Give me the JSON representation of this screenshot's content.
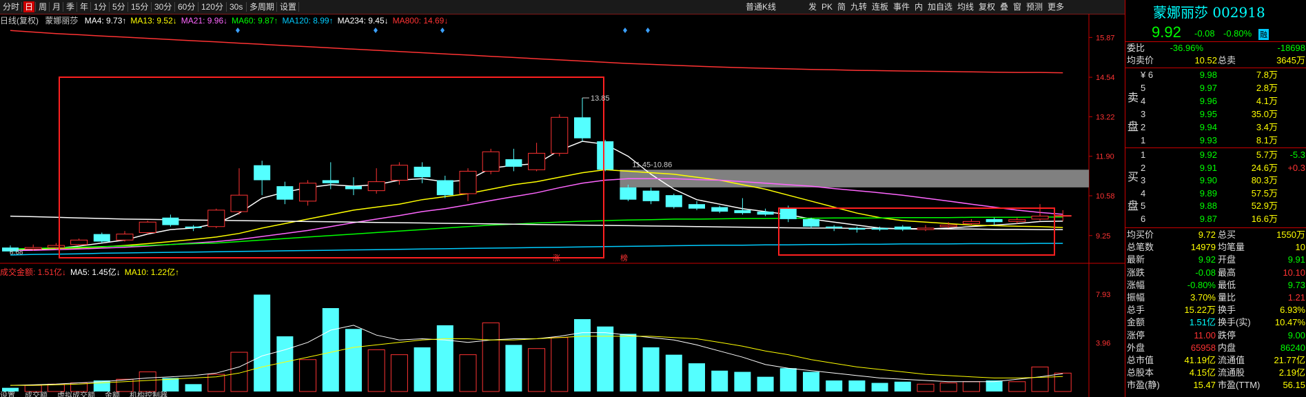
{
  "toolbar": {
    "items": [
      "分时",
      "日",
      "周",
      "月",
      "季",
      "年",
      "1分",
      "5分",
      "15分",
      "30分",
      "60分",
      "120分",
      "30s",
      "多周期",
      "设置"
    ],
    "selected": "日",
    "right_items": [
      "普通K线",
      "发",
      "PK",
      "简",
      "九转",
      "连板",
      "事件",
      "内",
      "加自选",
      "均线",
      "复权",
      "叠",
      "窗",
      "预测",
      "更多"
    ]
  },
  "ma_row": {
    "prefix": "日线(复权)",
    "stock": "蒙娜丽莎",
    "items": [
      {
        "label": "MA4: 9.73↑",
        "color": "#ffffff"
      },
      {
        "label": "MA13: 9.52↓",
        "color": "#ffff00"
      },
      {
        "label": "MA21: 9.96↓",
        "color": "#ff66ff"
      },
      {
        "label": "MA60: 9.87↑",
        "color": "#00ff00"
      },
      {
        "label": "MA120: 8.99↑",
        "color": "#00ccff"
      },
      {
        "label": "MA234: 9.45↓",
        "color": "#ffffff"
      },
      {
        "label": "MA800: 14.69↓",
        "color": "#ff3333"
      }
    ]
  },
  "price_axis": [
    "15.87",
    "14.54",
    "13.22",
    "11.90",
    "10.58",
    "9.25"
  ],
  "volume_axis": [
    "7.93",
    "3.96"
  ],
  "annotations": {
    "high_label": "13.85",
    "gap_label": "11.45-10.86",
    "low_label": "8.68",
    "markers": [
      "涨",
      "榜"
    ]
  },
  "volume_row": {
    "items": [
      {
        "label": "成交金额: 1.51亿↓",
        "color": "#ff3333"
      },
      {
        "label": "MA5: 1.45亿↓",
        "color": "#ffffff"
      },
      {
        "label": "MA10: 1.22亿↑",
        "color": "#ffff00"
      }
    ]
  },
  "bottom_tabs": [
    "设置",
    "成交额",
    "虚拟成交额",
    "金额",
    "机构控制器"
  ],
  "panel": {
    "title": "蒙娜丽莎 002918",
    "price": "9.92",
    "change": "-0.08",
    "change_pct": "-0.80%",
    "badge": "融",
    "weibi_label": "委比",
    "weibi_val": "-36.96%",
    "weicha_val": "-18698",
    "junmai_label": "均卖价",
    "junmai_val": "10.52",
    "zongmai_label": "总卖",
    "zongmai_val": "3645万",
    "sell_side_label": [
      "卖",
      "盘"
    ],
    "sell": [
      {
        "lvl": "¥ 6",
        "price": "9.98",
        "vol": "7.8万"
      },
      {
        "lvl": "5",
        "price": "9.97",
        "vol": "2.8万"
      },
      {
        "lvl": "4",
        "price": "9.96",
        "vol": "4.1万"
      },
      {
        "lvl": "3",
        "price": "9.95",
        "vol": "35.0万"
      },
      {
        "lvl": "2",
        "price": "9.94",
        "vol": "3.4万"
      },
      {
        "lvl": "1",
        "price": "9.93",
        "vol": "8.1万"
      }
    ],
    "buy_side_label": [
      "买",
      "盘"
    ],
    "buy": [
      {
        "lvl": "1",
        "price": "9.92",
        "vol": "5.7万",
        "chg": "-5.3"
      },
      {
        "lvl": "2",
        "price": "9.91",
        "vol": "24.6万",
        "chg": "+0.3"
      },
      {
        "lvl": "3",
        "price": "9.90",
        "vol": "80.3万",
        "chg": ""
      },
      {
        "lvl": "4",
        "price": "9.89",
        "vol": "57.5万",
        "chg": ""
      },
      {
        "lvl": "5",
        "price": "9.88",
        "vol": "52.9万",
        "chg": ""
      },
      {
        "lvl": "6",
        "price": "9.87",
        "vol": "16.6万",
        "chg": ""
      }
    ],
    "stats": [
      {
        "l1": "均买价",
        "v1": "9.72",
        "c1": "#ffff00",
        "l2": "总买",
        "v2": "1550万",
        "c2": "#ffff00"
      },
      {
        "l1": "总笔数",
        "v1": "14979",
        "c1": "#ffff00",
        "l2": "均笔量",
        "v2": "10",
        "c2": "#ffff00"
      },
      {
        "l1": "最新",
        "v1": "9.92",
        "c1": "#00ff00",
        "l2": "开盘",
        "v2": "9.91",
        "c2": "#00ff00"
      },
      {
        "l1": "涨跌",
        "v1": "-0.08",
        "c1": "#00ff00",
        "l2": "最高",
        "v2": "10.10",
        "c2": "#ff3333"
      },
      {
        "l1": "涨幅",
        "v1": "-0.80%",
        "c1": "#00ff00",
        "l2": "最低",
        "v2": "9.73",
        "c2": "#00ff00"
      },
      {
        "l1": "振幅",
        "v1": "3.70%",
        "c1": "#ffff00",
        "l2": "量比",
        "v2": "1.21",
        "c2": "#ff3333"
      },
      {
        "l1": "总手",
        "v1": "15.22万",
        "c1": "#ffff00",
        "l2": "换手",
        "v2": "6.93%",
        "c2": "#ffff00"
      },
      {
        "l1": "金额",
        "v1": "1.51亿",
        "c1": "#00ffff",
        "l2": "换手(实)",
        "v2": "10.47%",
        "c2": "#ffff00"
      },
      {
        "l1": "涨停",
        "v1": "11.00",
        "c1": "#ff3333",
        "l2": "跌停",
        "v2": "9.00",
        "c2": "#00ff00"
      },
      {
        "l1": "外盘",
        "v1": "65958",
        "c1": "#ff3333",
        "l2": "内盘",
        "v2": "86240",
        "c2": "#00ff00"
      },
      {
        "l1": "总市值",
        "v1": "41.19亿",
        "c1": "#ffff00",
        "l2": "流通值",
        "v2": "21.77亿",
        "c2": "#ffff00"
      },
      {
        "l1": "总股本",
        "v1": "4.15亿",
        "c1": "#ffff00",
        "l2": "流通股",
        "v2": "2.19亿",
        "c2": "#ffff00"
      },
      {
        "l1": "市盈(静)",
        "v1": "15.47",
        "c1": "#ffff00",
        "l2": "市盈(TTM)",
        "v2": "56.15",
        "c2": "#ffff00"
      }
    ]
  },
  "chart_data": {
    "type": "candlestick",
    "price_range": [
      8.6,
      16.2
    ],
    "volume_max": 8.6,
    "candles": [
      {
        "o": 8.85,
        "c": 8.72,
        "h": 8.92,
        "l": 8.68,
        "v": 0.3
      },
      {
        "o": 8.8,
        "c": 8.85,
        "h": 8.95,
        "l": 8.75,
        "v": 0.5
      },
      {
        "o": 8.85,
        "c": 8.92,
        "h": 9.0,
        "l": 8.8,
        "v": 0.6
      },
      {
        "o": 8.95,
        "c": 9.1,
        "h": 9.15,
        "l": 8.9,
        "v": 0.7
      },
      {
        "o": 9.3,
        "c": 9.05,
        "h": 9.35,
        "l": 9.0,
        "v": 0.9
      },
      {
        "o": 9.1,
        "c": 9.3,
        "h": 9.4,
        "l": 9.05,
        "v": 1.0
      },
      {
        "o": 9.35,
        "c": 9.7,
        "h": 9.75,
        "l": 9.3,
        "v": 1.6
      },
      {
        "o": 9.85,
        "c": 9.6,
        "h": 9.95,
        "l": 9.55,
        "v": 1.1
      },
      {
        "o": 9.55,
        "c": 9.5,
        "h": 9.6,
        "l": 9.4,
        "v": 0.6
      },
      {
        "o": 9.55,
        "c": 10.1,
        "h": 10.15,
        "l": 9.5,
        "v": 1.4
      },
      {
        "o": 10.05,
        "c": 10.6,
        "h": 11.5,
        "l": 9.95,
        "v": 3.2
      },
      {
        "o": 11.6,
        "c": 11.1,
        "h": 11.75,
        "l": 10.6,
        "v": 7.9
      },
      {
        "o": 10.9,
        "c": 10.45,
        "h": 11.05,
        "l": 10.3,
        "v": 4.5
      },
      {
        "o": 10.4,
        "c": 11.0,
        "h": 11.1,
        "l": 10.25,
        "v": 2.6
      },
      {
        "o": 11.1,
        "c": 11.0,
        "h": 11.7,
        "l": 10.8,
        "v": 6.8
      },
      {
        "o": 10.9,
        "c": 10.8,
        "h": 11.2,
        "l": 10.6,
        "v": 5.1
      },
      {
        "o": 10.75,
        "c": 11.05,
        "h": 11.5,
        "l": 10.65,
        "v": 3.4
      },
      {
        "o": 11.1,
        "c": 11.6,
        "h": 11.7,
        "l": 10.95,
        "v": 3.0
      },
      {
        "o": 11.55,
        "c": 11.2,
        "h": 11.7,
        "l": 11.0,
        "v": 3.6
      },
      {
        "o": 11.1,
        "c": 10.6,
        "h": 11.25,
        "l": 10.5,
        "v": 5.4
      },
      {
        "o": 10.65,
        "c": 11.4,
        "h": 11.5,
        "l": 10.4,
        "v": 3.0
      },
      {
        "o": 11.4,
        "c": 12.05,
        "h": 12.15,
        "l": 11.3,
        "v": 5.6
      },
      {
        "o": 11.8,
        "c": 11.55,
        "h": 12.15,
        "l": 11.4,
        "v": 3.8
      },
      {
        "o": 11.45,
        "c": 12.0,
        "h": 12.35,
        "l": 11.4,
        "v": 3.5
      },
      {
        "o": 12.0,
        "c": 13.2,
        "h": 13.3,
        "l": 11.9,
        "v": 4.4
      },
      {
        "o": 13.2,
        "c": 12.5,
        "h": 13.85,
        "l": 12.4,
        "v": 5.9
      },
      {
        "o": 12.4,
        "c": 11.45,
        "h": 12.45,
        "l": 11.4,
        "v": 5.3
      },
      {
        "o": 10.86,
        "c": 10.45,
        "h": 10.95,
        "l": 10.4,
        "v": 4.7
      },
      {
        "o": 10.75,
        "c": 10.4,
        "h": 10.85,
        "l": 10.3,
        "v": 3.6
      },
      {
        "o": 10.6,
        "c": 10.2,
        "h": 10.65,
        "l": 10.15,
        "v": 3.0
      },
      {
        "o": 10.3,
        "c": 10.15,
        "h": 10.4,
        "l": 10.1,
        "v": 2.3
      },
      {
        "o": 10.2,
        "c": 10.05,
        "h": 10.25,
        "l": 10.0,
        "v": 1.7
      },
      {
        "o": 10.1,
        "c": 10.0,
        "h": 10.5,
        "l": 9.95,
        "v": 1.6
      },
      {
        "o": 10.05,
        "c": 9.95,
        "h": 10.15,
        "l": 9.9,
        "v": 1.2
      },
      {
        "o": 10.15,
        "c": 9.8,
        "h": 10.25,
        "l": 9.7,
        "v": 1.9
      },
      {
        "o": 9.8,
        "c": 9.55,
        "h": 9.85,
        "l": 9.5,
        "v": 1.6
      },
      {
        "o": 9.55,
        "c": 9.5,
        "h": 9.6,
        "l": 9.4,
        "v": 0.9
      },
      {
        "o": 9.5,
        "c": 9.45,
        "h": 9.55,
        "l": 9.35,
        "v": 0.9
      },
      {
        "o": 9.5,
        "c": 9.45,
        "h": 9.55,
        "l": 9.4,
        "v": 0.7
      },
      {
        "o": 9.55,
        "c": 9.45,
        "h": 9.6,
        "l": 9.4,
        "v": 0.8
      },
      {
        "o": 9.45,
        "c": 9.5,
        "h": 9.6,
        "l": 9.4,
        "v": 0.6
      },
      {
        "o": 9.55,
        "c": 9.6,
        "h": 9.7,
        "l": 9.5,
        "v": 0.7
      },
      {
        "o": 9.65,
        "c": 9.72,
        "h": 9.8,
        "l": 9.6,
        "v": 0.8
      },
      {
        "o": 9.8,
        "c": 9.7,
        "h": 9.85,
        "l": 9.6,
        "v": 0.9
      },
      {
        "o": 9.72,
        "c": 9.78,
        "h": 9.85,
        "l": 9.65,
        "v": 0.8
      },
      {
        "o": 9.8,
        "c": 9.9,
        "h": 10.3,
        "l": 9.75,
        "v": 2.0
      },
      {
        "o": 9.91,
        "c": 9.92,
        "h": 10.1,
        "l": 9.73,
        "v": 1.5
      }
    ],
    "ma": {
      "MA4": {
        "color": "#ffffff",
        "values": [
          8.75,
          8.78,
          8.82,
          8.9,
          9.0,
          9.1,
          9.3,
          9.45,
          9.5,
          9.65,
          10.0,
          10.5,
          10.7,
          10.85,
          10.95,
          10.9,
          10.95,
          11.1,
          11.15,
          11.05,
          11.1,
          11.5,
          11.6,
          11.65,
          12.1,
          12.4,
          12.3,
          11.9,
          11.3,
          10.8,
          10.45,
          10.3,
          10.15,
          10.05,
          9.95,
          9.8,
          9.7,
          9.6,
          9.5,
          9.47,
          9.47,
          9.5,
          9.55,
          9.6,
          9.65,
          9.72,
          9.73
        ]
      },
      "MA13": {
        "color": "#ffff00",
        "values": [
          8.8,
          8.8,
          8.82,
          8.84,
          8.87,
          8.92,
          8.98,
          9.05,
          9.12,
          9.2,
          9.32,
          9.5,
          9.65,
          9.8,
          9.95,
          10.1,
          10.2,
          10.3,
          10.45,
          10.55,
          10.65,
          10.8,
          10.95,
          11.05,
          11.2,
          11.35,
          11.45,
          11.4,
          11.35,
          11.3,
          11.2,
          11.1,
          10.95,
          10.8,
          10.6,
          10.4,
          10.2,
          10.0,
          9.85,
          9.75,
          9.7,
          9.65,
          9.6,
          9.58,
          9.56,
          9.55,
          9.52
        ]
      },
      "MA21": {
        "color": "#ff66ff",
        "values": [
          8.75,
          8.76,
          8.78,
          8.8,
          8.83,
          8.86,
          8.9,
          8.95,
          9.0,
          9.05,
          9.12,
          9.22,
          9.32,
          9.42,
          9.55,
          9.68,
          9.8,
          9.92,
          10.05,
          10.15,
          10.28,
          10.42,
          10.55,
          10.68,
          10.85,
          11.0,
          11.1,
          11.15,
          11.15,
          11.15,
          11.12,
          11.1,
          11.05,
          11.0,
          10.95,
          10.9,
          10.82,
          10.75,
          10.68,
          10.6,
          10.5,
          10.4,
          10.3,
          10.2,
          10.1,
          10.02,
          9.96
        ]
      },
      "MA60": {
        "color": "#00ff00",
        "values": [
          8.8,
          8.82,
          8.84,
          8.86,
          8.88,
          8.9,
          8.92,
          8.95,
          8.98,
          9.0,
          9.05,
          9.1,
          9.15,
          9.2,
          9.25,
          9.3,
          9.35,
          9.4,
          9.45,
          9.5,
          9.55,
          9.6,
          9.63,
          9.67,
          9.7,
          9.73,
          9.75,
          9.77,
          9.78,
          9.8,
          9.8,
          9.81,
          9.82,
          9.82,
          9.83,
          9.83,
          9.84,
          9.84,
          9.84,
          9.85,
          9.85,
          9.85,
          9.86,
          9.86,
          9.86,
          9.87,
          9.87
        ]
      },
      "MA120": {
        "color": "#00ccff",
        "values": [
          8.6,
          8.62,
          8.63,
          8.64,
          8.66,
          8.67,
          8.68,
          8.69,
          8.7,
          8.71,
          8.72,
          8.73,
          8.74,
          8.75,
          8.76,
          8.77,
          8.78,
          8.79,
          8.8,
          8.81,
          8.82,
          8.83,
          8.84,
          8.85,
          8.86,
          8.87,
          8.88,
          8.89,
          8.9,
          8.91,
          8.92,
          8.93,
          8.93,
          8.94,
          8.94,
          8.95,
          8.95,
          8.96,
          8.96,
          8.97,
          8.97,
          8.97,
          8.98,
          8.98,
          8.98,
          8.99,
          8.99
        ]
      },
      "MA234": {
        "color": "#ffffff",
        "values": [
          9.9,
          9.88,
          9.86,
          9.84,
          9.82,
          9.8,
          9.79,
          9.78,
          9.77,
          9.76,
          9.75,
          9.74,
          9.73,
          9.72,
          9.71,
          9.7,
          9.69,
          9.68,
          9.67,
          9.66,
          9.65,
          9.64,
          9.63,
          9.62,
          9.61,
          9.6,
          9.59,
          9.58,
          9.57,
          9.56,
          9.55,
          9.54,
          9.53,
          9.52,
          9.51,
          9.5,
          9.5,
          9.49,
          9.49,
          9.48,
          9.48,
          9.47,
          9.47,
          9.46,
          9.46,
          9.45,
          9.45
        ]
      },
      "MA800": {
        "color": "#ff3333",
        "values": [
          16.1,
          16.05,
          16.0,
          15.96,
          15.92,
          15.88,
          15.84,
          15.8,
          15.76,
          15.72,
          15.68,
          15.64,
          15.6,
          15.56,
          15.52,
          15.48,
          15.44,
          15.4,
          15.36,
          15.32,
          15.28,
          15.24,
          15.2,
          15.16,
          15.12,
          15.08,
          15.04,
          15.0,
          14.97,
          14.94,
          14.91,
          14.88,
          14.86,
          14.84,
          14.82,
          14.8,
          14.79,
          14.77,
          14.76,
          14.75,
          14.74,
          14.73,
          14.72,
          14.71,
          14.7,
          14.7,
          14.69
        ]
      }
    },
    "vol_ma": {
      "MA5": {
        "color": "#ffffff",
        "values": [
          0.5,
          0.55,
          0.6,
          0.7,
          0.8,
          0.95,
          1.1,
          1.2,
          1.3,
          1.5,
          2.0,
          2.9,
          3.4,
          4.0,
          5.0,
          5.4,
          4.6,
          4.2,
          4.3,
          4.2,
          4.0,
          4.2,
          4.3,
          4.3,
          4.5,
          4.8,
          4.8,
          4.6,
          4.4,
          4.2,
          3.8,
          3.3,
          2.8,
          2.2,
          1.9,
          1.7,
          1.5,
          1.3,
          1.1,
          1.0,
          0.9,
          0.8,
          0.8,
          0.8,
          1.0,
          1.2,
          1.45
        ]
      },
      "MA10": {
        "color": "#ffff00",
        "values": [
          0.5,
          0.5,
          0.55,
          0.6,
          0.7,
          0.8,
          0.9,
          1.0,
          1.1,
          1.2,
          1.5,
          2.0,
          2.4,
          2.8,
          3.2,
          3.6,
          3.8,
          4.0,
          4.2,
          4.3,
          4.3,
          4.2,
          4.2,
          4.3,
          4.4,
          4.5,
          4.5,
          4.5,
          4.5,
          4.4,
          4.3,
          4.0,
          3.7,
          3.3,
          3.0,
          2.6,
          2.3,
          2.0,
          1.8,
          1.6,
          1.4,
          1.3,
          1.2,
          1.1,
          1.1,
          1.15,
          1.22
        ]
      }
    },
    "overlay_lines": {
      "yellow_flat": 9.45,
      "white_flat": 9.4
    },
    "gap_zone": [
      10.86,
      11.45
    ]
  }
}
